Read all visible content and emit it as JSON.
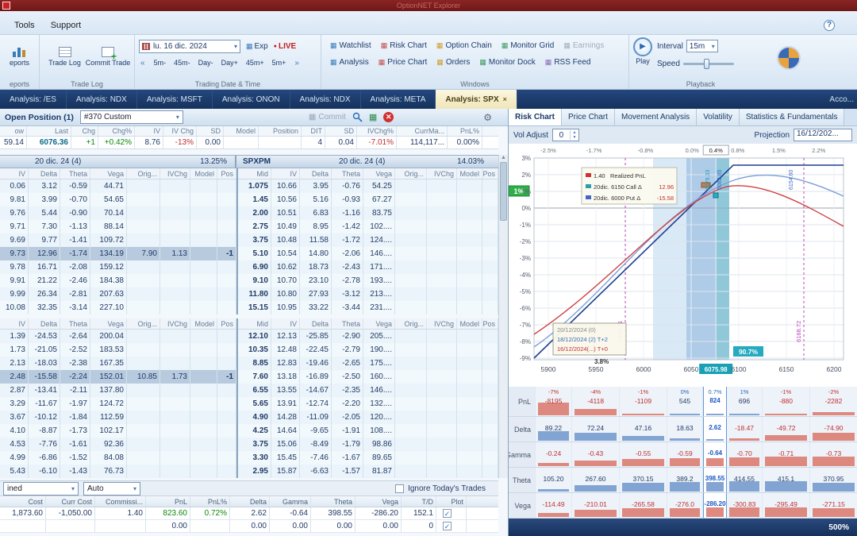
{
  "titlebar": {
    "title": "OptionNET Explorer"
  },
  "menu": {
    "items": [
      "Tools",
      "Support"
    ],
    "help": "?"
  },
  "icons": {
    "dropdown": "▾",
    "left_arrows": "«",
    "right_arrows": "»",
    "close": "✕",
    "check": "✓",
    "up": "▲",
    "down": "▼",
    "play": "▶",
    "gear": "⚙",
    "export": "▦",
    "live_dot": "●",
    "commit_grid": "▦"
  },
  "ribbon": {
    "reports": {
      "button": "eports",
      "group": "eports"
    },
    "tradelog": {
      "b1": "Trade Log",
      "b2": "Commit Trade",
      "group": "Trade Log"
    },
    "datetime": {
      "date": "lu. 16 dic. 2024",
      "exp": "Exp",
      "live": "LIVE",
      "steps": [
        "5m-",
        "45m-",
        "Day-",
        "Day+",
        "45m+",
        "5m+"
      ],
      "group": "Trading Date & Time"
    },
    "windows": {
      "row1": [
        "Watchlist",
        "Risk Chart",
        "Option Chain",
        "Monitor Grid",
        "Earnings"
      ],
      "row2": [
        "Analysis",
        "Price Chart",
        "Orders",
        "Monitor Dock",
        "RSS Feed"
      ],
      "group": "Windows"
    },
    "playback": {
      "play": "Play",
      "interval_label": "Interval",
      "interval": "15m",
      "speed": "Speed",
      "group": "Playback"
    }
  },
  "tabs": {
    "items": [
      "Analysis: /ES",
      "Analysis: NDX",
      "Analysis: MSFT",
      "Analysis: ONON",
      "Analysis: NDX",
      "Analysis: META",
      "Analysis: SPX"
    ],
    "active_index": 6,
    "close": "×",
    "right": "Acco..."
  },
  "position": {
    "title": "Open Position (1)",
    "selector": "#370 Custom",
    "commit": "Commit",
    "quote": {
      "headers_left": [
        "ow",
        "Last",
        "Chg",
        "Chg%",
        "IV",
        "IV Chg",
        "SD",
        "Model",
        "Position"
      ],
      "values_left": [
        "59.14",
        "6076.36",
        "+1",
        "+0.42%",
        "8.76",
        "-13%",
        "0.00",
        "",
        ""
      ],
      "headers_right": [
        "DIT",
        "SD",
        "IVChg%",
        "CurrMa...",
        "PnL%"
      ],
      "values_right": [
        "4",
        "0.04",
        "-7.01%",
        "114,117...",
        "0.00%"
      ]
    },
    "sections": [
      {
        "exp_left": "20 dic. 24 (4)",
        "iv_left": "13.25%",
        "sym": "SPXPM",
        "exp_right": "20 dic. 24 (4)",
        "iv_right": "14.03%",
        "cols_left": [
          "IV",
          "Delta",
          "Theta",
          "Vega",
          "Orig...",
          "IVChg",
          "Model",
          "Pos"
        ],
        "cols_right": [
          "Mid",
          "IV",
          "Delta",
          "Theta",
          "Vega",
          "Orig...",
          "IVChg",
          "Model",
          "Pos"
        ],
        "selected": 5,
        "rows_left": [
          [
            "0.06",
            "3.12",
            "-0.59",
            "44.71",
            "",
            "",
            "",
            ""
          ],
          [
            "9.81",
            "3.99",
            "-0.70",
            "54.65",
            "",
            "",
            "",
            ""
          ],
          [
            "9.76",
            "5.44",
            "-0.90",
            "70.14",
            "",
            "",
            "",
            ""
          ],
          [
            "9.71",
            "7.30",
            "-1.13",
            "88.14",
            "",
            "",
            "",
            ""
          ],
          [
            "9.69",
            "9.77",
            "-1.41",
            "109.72",
            "",
            "",
            "",
            ""
          ],
          [
            "9.73",
            "12.96",
            "-1.74",
            "134.19",
            "7.90",
            "1.13",
            "",
            "-1"
          ],
          [
            "9.78",
            "16.71",
            "-2.08",
            "159.12",
            "",
            "",
            "",
            ""
          ],
          [
            "9.91",
            "21.22",
            "-2.46",
            "184.38",
            "",
            "",
            "",
            ""
          ],
          [
            "9.99",
            "26.34",
            "-2.81",
            "207.63",
            "",
            "",
            "",
            ""
          ],
          [
            "10.08",
            "32.35",
            "-3.14",
            "227.10",
            "",
            "",
            "",
            ""
          ]
        ],
        "rows_right": [
          [
            "1.075",
            "10.66",
            "3.95",
            "-0.76",
            "54.25",
            "",
            "",
            "",
            ""
          ],
          [
            "1.45",
            "10.56",
            "5.16",
            "-0.93",
            "67.27",
            "",
            "",
            "",
            ""
          ],
          [
            "2.00",
            "10.51",
            "6.83",
            "-1.16",
            "83.75",
            "",
            "",
            "",
            ""
          ],
          [
            "2.75",
            "10.49",
            "8.95",
            "-1.42",
            "102....",
            "",
            "",
            "",
            ""
          ],
          [
            "3.75",
            "10.48",
            "11.58",
            "-1.72",
            "124....",
            "",
            "",
            "",
            ""
          ],
          [
            "5.10",
            "10.54",
            "14.80",
            "-2.06",
            "146....",
            "",
            "",
            "",
            ""
          ],
          [
            "6.90",
            "10.62",
            "18.73",
            "-2.43",
            "171....",
            "",
            "",
            "",
            ""
          ],
          [
            "9.10",
            "10.70",
            "23.10",
            "-2.78",
            "193....",
            "",
            "",
            "",
            ""
          ],
          [
            "11.80",
            "10.80",
            "27.93",
            "-3.12",
            "213....",
            "",
            "",
            "",
            ""
          ],
          [
            "15.15",
            "10.95",
            "33.22",
            "-3.44",
            "231....",
            "",
            "",
            "",
            ""
          ]
        ]
      },
      {
        "exp_left": "",
        "iv_left": "",
        "sym": "",
        "exp_right": "",
        "iv_right": "",
        "cols_left": [
          "IV",
          "Delta",
          "Theta",
          "Vega",
          "Orig...",
          "IVChg",
          "Model",
          "Pos"
        ],
        "cols_right": [
          "Mid",
          "IV",
          "Delta",
          "Theta",
          "Vega",
          "Orig...",
          "IVChg",
          "Model",
          "Pos"
        ],
        "selected": 3,
        "rows_left": [
          [
            "1.39",
            "-24.53",
            "-2.64",
            "200.04",
            "",
            "",
            "",
            ""
          ],
          [
            "1.73",
            "-21.05",
            "-2.52",
            "183.53",
            "",
            "",
            "",
            ""
          ],
          [
            "2.13",
            "-18.03",
            "-2.38",
            "167.35",
            "",
            "",
            "",
            ""
          ],
          [
            "2.48",
            "-15.58",
            "-2.24",
            "152.01",
            "10.85",
            "1.73",
            "",
            "-1"
          ],
          [
            "2.87",
            "-13.41",
            "-2.11",
            "137.80",
            "",
            "",
            "",
            ""
          ],
          [
            "3.29",
            "-11.67",
            "-1.97",
            "124.72",
            "",
            "",
            "",
            ""
          ],
          [
            "3.67",
            "-10.12",
            "-1.84",
            "112.59",
            "",
            "",
            "",
            ""
          ],
          [
            "4.10",
            "-8.87",
            "-1.73",
            "102.17",
            "",
            "",
            "",
            ""
          ],
          [
            "4.53",
            "-7.76",
            "-1.61",
            "92.36",
            "",
            "",
            "",
            ""
          ],
          [
            "4.99",
            "-6.86",
            "-1.52",
            "84.08",
            "",
            "",
            "",
            ""
          ],
          [
            "5.43",
            "-6.10",
            "-1.43",
            "76.73",
            "",
            "",
            "",
            ""
          ]
        ],
        "rows_right": [
          [
            "12.10",
            "12.13",
            "-25.85",
            "-2.90",
            "205....",
            "",
            "",
            "",
            ""
          ],
          [
            "10.35",
            "12.48",
            "-22.45",
            "-2.79",
            "190....",
            "",
            "",
            "",
            ""
          ],
          [
            "8.85",
            "12.83",
            "-19.46",
            "-2.65",
            "175....",
            "",
            "",
            "",
            ""
          ],
          [
            "7.60",
            "13.18",
            "-16.89",
            "-2.50",
            "160....",
            "",
            "",
            "",
            ""
          ],
          [
            "6.55",
            "13.55",
            "-14.67",
            "-2.35",
            "146....",
            "",
            "",
            "",
            ""
          ],
          [
            "5.65",
            "13.91",
            "-12.74",
            "-2.20",
            "132....",
            "",
            "",
            "",
            ""
          ],
          [
            "4.90",
            "14.28",
            "-11.09",
            "-2.05",
            "120....",
            "",
            "",
            "",
            ""
          ],
          [
            "4.25",
            "14.64",
            "-9.65",
            "-1.91",
            "108....",
            "",
            "",
            "",
            ""
          ],
          [
            "3.75",
            "15.06",
            "-8.49",
            "-1.79",
            "98.86",
            "",
            "",
            "",
            ""
          ],
          [
            "3.30",
            "15.45",
            "-7.46",
            "-1.67",
            "89.65",
            "",
            "",
            "",
            ""
          ],
          [
            "2.95",
            "15.87",
            "-6.63",
            "-1.57",
            "81.87",
            "",
            "",
            "",
            ""
          ]
        ]
      }
    ],
    "footer": {
      "combined": "ined",
      "auto": "Auto",
      "ignore": "Ignore Today's Trades",
      "headers": [
        "Cost",
        "Curr Cost",
        "Commissi...",
        "PnL",
        "PnL%",
        "Delta",
        "Gamma",
        "Theta",
        "Vega",
        "T/D",
        "Plot"
      ],
      "rows": [
        [
          "1,873.60",
          "-1,050.00",
          "1.40",
          "823.60",
          "0.72%",
          "2.62",
          "-0.64",
          "398.55",
          "-286.20",
          "152.1",
          "check"
        ],
        [
          "",
          "",
          "",
          "0.00",
          "",
          "0.00",
          "0.00",
          "0.00",
          "0.00",
          "0",
          "check"
        ]
      ]
    }
  },
  "risk": {
    "tabs": [
      "Risk Chart",
      "Price Chart",
      "Movement Analysis",
      "Volatility",
      "Statistics & Fundamentals"
    ],
    "active_tab": 0,
    "vol_adjust_label": "Vol Adjust",
    "vol_adjust": "0",
    "projection_label": "Projection",
    "projection": "16/12/202...",
    "zoom": "500%"
  },
  "chart": {
    "y_ticks": [
      "3%",
      "2%",
      "1%",
      "0%",
      "-1%",
      "-2%",
      "-3%",
      "-4%",
      "-5%",
      "-6%",
      "-7%",
      "-8%",
      "-9%"
    ],
    "x_pct": [
      "-2.5%",
      "-1.7%",
      "-0.8%",
      "0.0%",
      "0.4%",
      "0.8%",
      "1.5%",
      "2.2%"
    ],
    "x_ticks": [
      "5900",
      "5950",
      "6000",
      "6050",
      "6075.98",
      "6100",
      "6150",
      "6200"
    ],
    "pnl_badge": "1%",
    "prob": "90.7%",
    "sd_left": "5980.81",
    "sd_right": "6168.72",
    "entry_marks": [
      "6079.33",
      "6082.85",
      "6154.60"
    ],
    "legend": {
      "items": [
        {
          "name": "Realized PnL",
          "value": "1.40"
        },
        {
          "name": "20dic. 6150 Call Δ",
          "value": "12.96"
        },
        {
          "name": "20dic. 6000 Put Δ",
          "value": "-15.58"
        }
      ]
    },
    "tooltip": {
      "lines": [
        "20/12/2024 (0)",
        "18/12/2024 (2) T+2",
        "16/12/2024(...) T+0"
      ],
      "pct": "3.8%"
    },
    "series": [
      {
        "name": "Expiration",
        "color": "#1f3f8f",
        "points_pct": [
          [
            5885,
            -8.7
          ],
          [
            6080,
            2.5
          ],
          [
            6210,
            2.5
          ]
        ]
      },
      {
        "name": "T+2",
        "color": "#7aa0d8",
        "points_pct": [
          [
            5885,
            -8.3
          ],
          [
            6000,
            -2.0
          ],
          [
            6090,
            2.0
          ],
          [
            6210,
            0.8
          ]
        ]
      },
      {
        "name": "T+0",
        "color": "#d04040",
        "points_pct": [
          [
            5885,
            -7.6
          ],
          [
            6000,
            -1.2
          ],
          [
            6075,
            1.4
          ],
          [
            6210,
            -1.1
          ]
        ]
      }
    ]
  },
  "greeks": {
    "labels": [
      "PnL",
      "Delta",
      "Gamma",
      "Theta",
      "Vega"
    ],
    "pnl_pct": [
      "-7%",
      "-4%",
      "-1%",
      "0%",
      "0.7%",
      "1%",
      "-1%",
      "-2%"
    ],
    "pnl": [
      "-8195",
      "-4118",
      "-1109",
      "545",
      "824",
      "696",
      "-880",
      "-2282"
    ],
    "delta": [
      "89.22",
      "72.24",
      "47.16",
      "18.63",
      "2.62",
      "-18.47",
      "-49.72",
      "-74.90"
    ],
    "gamma": [
      "-0.24",
      "-0.43",
      "-0.55",
      "-0.59",
      "-0.64",
      "-0.70",
      "-0.71",
      "-0.73"
    ],
    "theta": [
      "105.20",
      "267.60",
      "370.15",
      "389.2",
      "398.55",
      "414.55",
      "415.1",
      "370.95"
    ],
    "vega": [
      "-114.49",
      "-210.01",
      "-265.58",
      "-276.0",
      "-286.20",
      "-300.83",
      "-295.49",
      "-271.15"
    ]
  }
}
